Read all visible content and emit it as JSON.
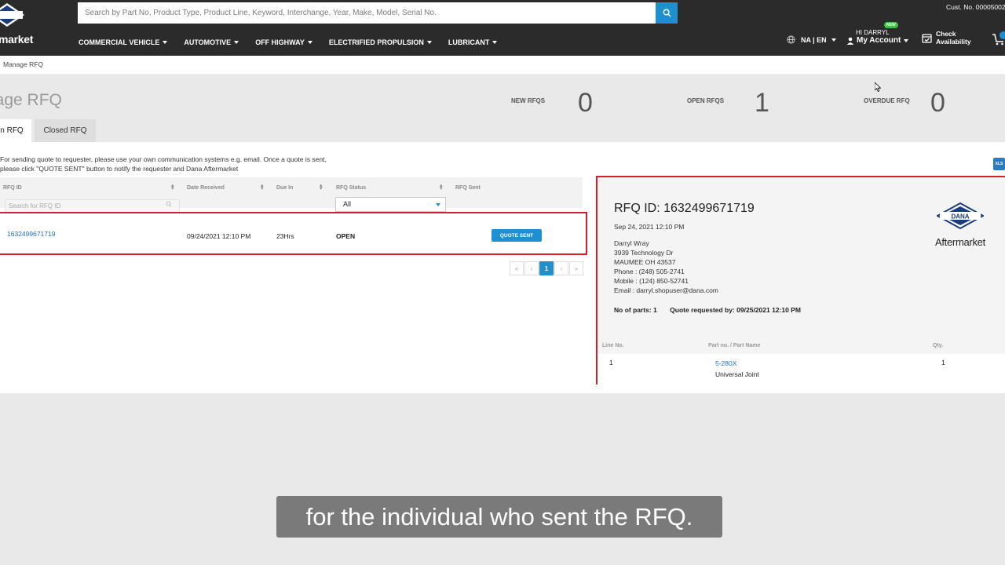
{
  "header": {
    "logo_badge": "DANA",
    "logo_word": "market",
    "search_placeholder": "Search by Part No, Product Type, Product Line, Keyword, Interchange, Year, Make, Model, Serial No.",
    "nav": [
      "COMMERCIAL VEHICLE",
      "AUTOMOTIVE",
      "OFF HIGHWAY",
      "ELECTRIFIED PROPULSION",
      "LUBRICANT"
    ],
    "cust_no": "Cust. No. 00005002",
    "region": "NA | EN",
    "greeting": "HI DARRYL",
    "new_badge": "NEW",
    "account_label": "My Account",
    "check_line1": "Check",
    "check_line2": "Availability"
  },
  "breadcrumb": "Manage RFQ",
  "page": {
    "title": "nage RFQ",
    "stats": [
      {
        "label": "NEW RFQS",
        "value": "0"
      },
      {
        "label": "OPEN RFQS",
        "value": "1"
      },
      {
        "label": "OVERDUE RFQ",
        "value": "0"
      }
    ],
    "tabs": {
      "open": "n RFQ",
      "closed": "Closed RFQ"
    }
  },
  "instructions": {
    "line1": "For sending quote to requester, please use your own communication systems e.g. email. Once a quote is sent,",
    "line2": "please click \"QUOTE SENT\" button to notify the requester and Dana Aftermarket"
  },
  "grid": {
    "columns": {
      "rfq_id": "RFQ ID",
      "date_received": "Date Received",
      "due_in": "Due In",
      "rfq_status": "RFQ Status",
      "rfq_sent": "RFQ Sent"
    },
    "filter_placeholder": "Search for RFQ ID",
    "status_filter": "All",
    "rows": [
      {
        "rfq_id": "1632499671719",
        "date_received": "09/24/2021 12:10 PM",
        "due_in": "23Hrs",
        "status": "OPEN",
        "action": "QUOTE SENT"
      }
    ],
    "pager": {
      "first": "«",
      "prev": "‹",
      "current": "1",
      "next": "›",
      "last": "»"
    },
    "export_label": "XLS"
  },
  "detail": {
    "title": "RFQ ID: 1632499671719",
    "date": "Sep 24, 2021 12:10 PM",
    "name": "Darryl Wray",
    "street": "3939 Technology Dr",
    "city": "MAUMEE OH 43537",
    "phone": "Phone : (248) 505-2741",
    "mobile": "Mobile : (124) 850-52741",
    "email": "Email : darryl.shopuser@dana.com",
    "parts_count": "No of parts: 1",
    "requested_by": "Quote requested by: 09/25/2021 12:10 PM",
    "logo_badge": "DANA",
    "logo_word": "Aftermarket",
    "table_headers": {
      "line": "Line No.",
      "part": "Part no. / Part Name",
      "qty": "Qty."
    },
    "items": [
      {
        "line": "1",
        "part_no": "5-280X",
        "part_name": "Universal Joint",
        "qty": "1"
      }
    ]
  },
  "caption": "for the individual who sent the RFQ.",
  "colors": {
    "accent": "#1e90d0",
    "highlight_border": "#d4202c",
    "header_bg": "#2b2b2b"
  }
}
